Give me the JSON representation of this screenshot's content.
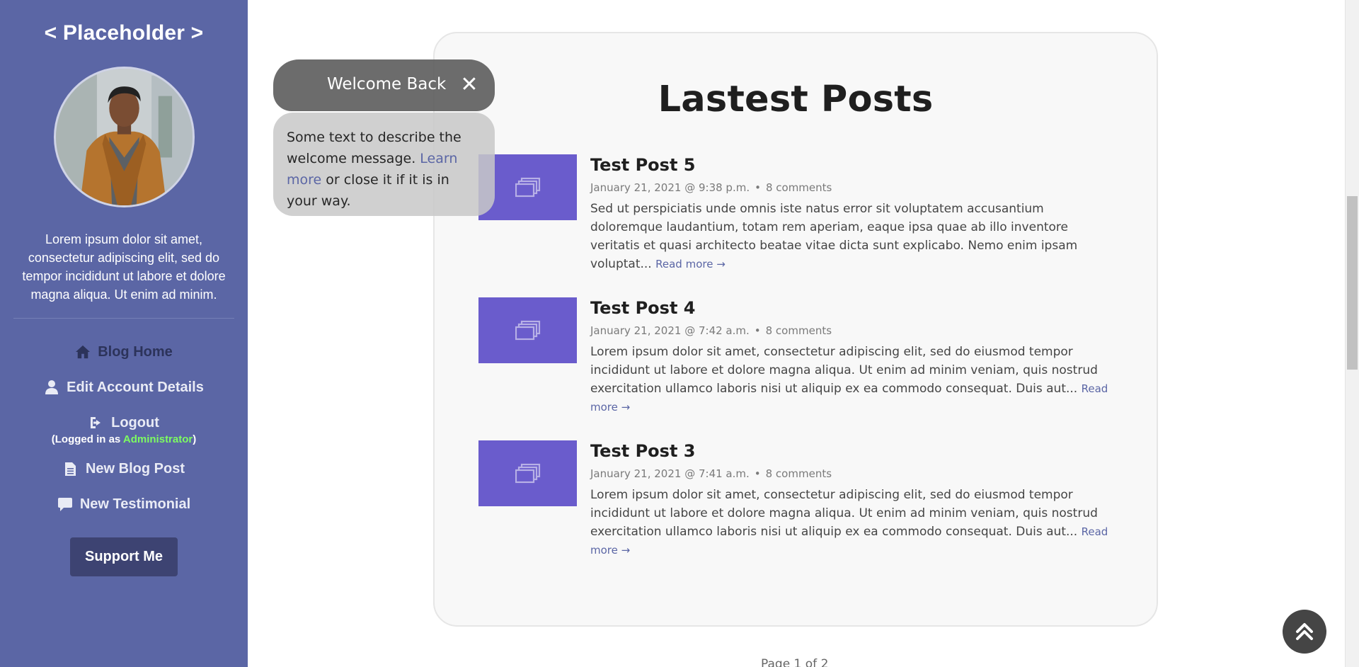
{
  "sidebar": {
    "site_title": "< Placeholder >",
    "bio": "Lorem ipsum dolor sit amet, consectetur adipiscing elit, sed do tempor incididunt ut labore et dolore magna aliqua. Ut enim ad minim.",
    "nav": {
      "blog_home": "Blog Home",
      "edit_account": "Edit Account Details",
      "logout": "Logout",
      "logged_in_prefix": "(Logged in as ",
      "logged_in_role": "Administrator",
      "logged_in_suffix": ")",
      "new_blog_post": "New Blog Post",
      "new_testimonial": "New Testimonial"
    },
    "support_label": "Support Me"
  },
  "main": {
    "title": "Lastest Posts",
    "posts": [
      {
        "title": "Test Post 5",
        "date": "January 21, 2021 @ 9:38 p.m.",
        "comments": "8 comments",
        "excerpt": "Sed ut perspiciatis unde omnis iste natus error sit voluptatem accusantium doloremque laudantium, totam rem aperiam, eaque ipsa quae ab illo inventore veritatis et quasi architecto beatae vitae dicta sunt explicabo. Nemo enim ipsam voluptat...",
        "read_more": "Read more →"
      },
      {
        "title": "Test Post 4",
        "date": "January 21, 2021 @ 7:42 a.m.",
        "comments": "8 comments",
        "excerpt": "Lorem ipsum dolor sit amet, consectetur adipiscing elit, sed do eiusmod tempor incididunt ut labore et dolore magna aliqua. Ut enim ad minim veniam, quis nostrud exercitation ullamco laboris nisi ut aliquip ex ea commodo consequat. Duis aut...",
        "read_more": "Read more →"
      },
      {
        "title": "Test Post 3",
        "date": "January 21, 2021 @ 7:41 a.m.",
        "comments": "8 comments",
        "excerpt": "Lorem ipsum dolor sit amet, consectetur adipiscing elit, sed do eiusmod tempor incididunt ut labore et dolore magna aliqua. Ut enim ad minim veniam, quis nostrud exercitation ullamco laboris nisi ut aliquip ex ea commodo consequat. Duis aut...",
        "read_more": "Read more →"
      }
    ],
    "meta_separator": "•",
    "pagination": "Page 1 of 2"
  },
  "welcome": {
    "title": "Welcome Back",
    "close_symbol": "✕",
    "text_before": "Some text to describe the welcome message. ",
    "link": "Learn more",
    "text_after": " or close it if it is in your way."
  },
  "icons": {
    "home": "home-icon",
    "user": "user-icon",
    "logout": "sign-out-icon",
    "file": "file-icon",
    "comment": "comment-icon",
    "thumbnail": "images-icon",
    "back_to_top": "double-chevron-up-icon"
  },
  "colors": {
    "sidebar_bg": "#5b66a5",
    "thumb_bg": "#6a5ccc",
    "role_green": "#7dfc61",
    "support_btn": "#3d4372",
    "link": "#5b66a5"
  }
}
